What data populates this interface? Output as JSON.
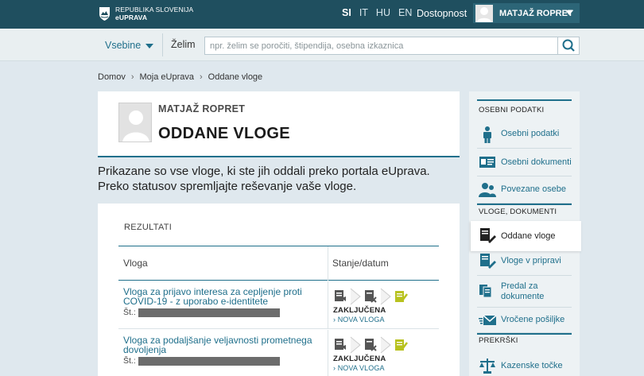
{
  "header": {
    "logo_line1": "REPUBLIKA SLOVENIJA",
    "logo_line2": "eUPRAVA",
    "languages": [
      "SI",
      "IT",
      "HU",
      "EN"
    ],
    "active_language": "SI",
    "accessibility": "Dostopnost",
    "user_name": "MATJAŽ ROPRET",
    "bar_color": "#1f4f5f"
  },
  "search": {
    "menu_label": "Vsebine",
    "want_label": "Želim",
    "placeholder": "npr. želim se poročiti, štipendija, osebna izkaznica"
  },
  "breadcrumb": [
    "Domov",
    "Moja eUprava",
    "Oddane vloge"
  ],
  "profile": {
    "name": "MATJAŽ ROPRET",
    "title": "ODDANE VLOGE"
  },
  "intro": {
    "line1": "Prikazane so vse vloge, ki ste jih oddali preko portala eUprava.",
    "line2": "Preko statusov spremljajte reševanje vaše vloge."
  },
  "results": {
    "heading": "REZULTATI",
    "col_vloga": "Vloga",
    "col_stanje": "Stanje/datum",
    "rows": [
      {
        "name": "Vloga za prijavo interesa za cepljenje proti COVID-19 - z uporabo e-identitete",
        "st_label": "Št.:",
        "status": "ZAKLJUČENA",
        "new_link": "› NOVA VLOGA"
      },
      {
        "name": "Vloga za podaljšanje veljavnosti prometnega dovoljenja",
        "st_label": "Št.:",
        "status": "ZAKLJUČENA",
        "new_link": "› NOVA VLOGA"
      }
    ]
  },
  "sidebar": {
    "section1": "OSEBNI PODATKI",
    "item_osebni_podatki": "Osebni podatki",
    "item_osebni_dokumenti": "Osebni dokumenti",
    "item_povezane_osebe": "Povezane osebe",
    "section2": "VLOGE, DOKUMENTI",
    "item_oddane_vloge": "Oddane vloge",
    "item_vloge_v_pripravi": "Vloge v pripravi",
    "item_predal": "Predal za dokumente",
    "item_vrocene": "Vročene pošiljke",
    "section3": "PREKRŠKI",
    "item_kazenske": "Kazenske točke"
  },
  "colors": {
    "accent": "#1f6f8b",
    "done_check": "#b8c21f"
  },
  "icons": [
    "slovenia-shield-icon",
    "avatar-icon",
    "search-icon",
    "person-icon",
    "id-card-icon",
    "people-icon",
    "document-pen-icon",
    "inbox-icon",
    "envelope-icon",
    "scales-icon"
  ]
}
